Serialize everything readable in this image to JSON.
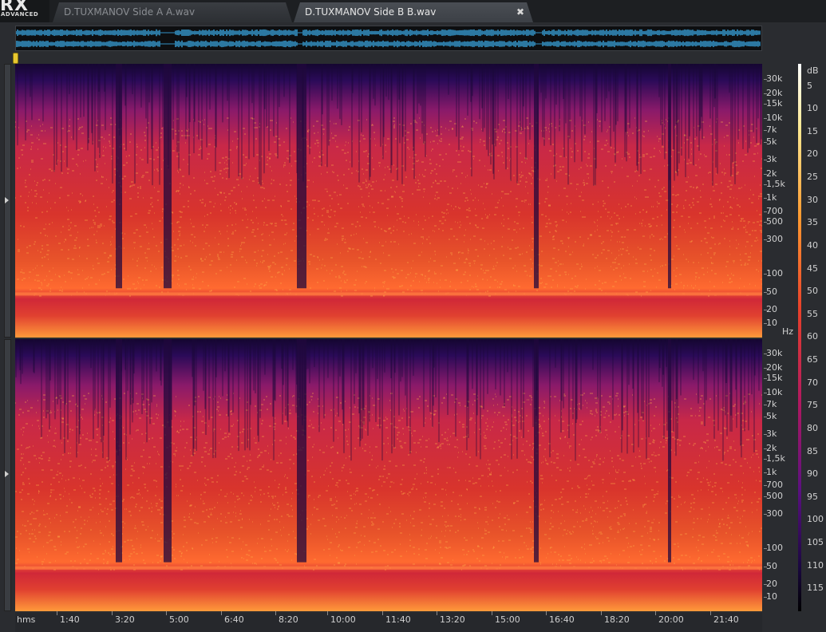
{
  "app": {
    "logo_main": "RX",
    "logo_sub": "ADVANCED"
  },
  "tabs": [
    {
      "label": "D.TUXMANOV Side A A.wav",
      "active": false
    },
    {
      "label": "D.TUXMANOV Side B B.wav",
      "active": true
    }
  ],
  "close_glyph": "✖",
  "freq_axis": {
    "unit": "Hz",
    "labels": [
      "30k",
      "20k",
      "15k",
      "10k",
      "7k",
      "5k",
      "3k",
      "2k",
      "1,5k",
      "1k",
      "700",
      "500",
      "300",
      "100",
      "50",
      "20",
      "10"
    ]
  },
  "db_scale": {
    "unit": "dB",
    "labels": [
      "5",
      "10",
      "15",
      "20",
      "25",
      "30",
      "35",
      "40",
      "45",
      "50",
      "55",
      "60",
      "65",
      "70",
      "75",
      "80",
      "85",
      "90",
      "95",
      "100",
      "105",
      "110",
      "115"
    ]
  },
  "time_axis": {
    "unit": "hms",
    "labels": [
      "1:40",
      "3:20",
      "5:00",
      "6:40",
      "8:20",
      "10:00",
      "11:40",
      "13:20",
      "15:00",
      "16:40",
      "18:20",
      "20:00",
      "21:40"
    ]
  },
  "colors": {
    "waveform": "#3aa6e0",
    "spectrum_low": "#1a0838",
    "spectrum_mid": "#c0204a",
    "spectrum_high": "#ffb040",
    "playhead": "#e8c830"
  }
}
